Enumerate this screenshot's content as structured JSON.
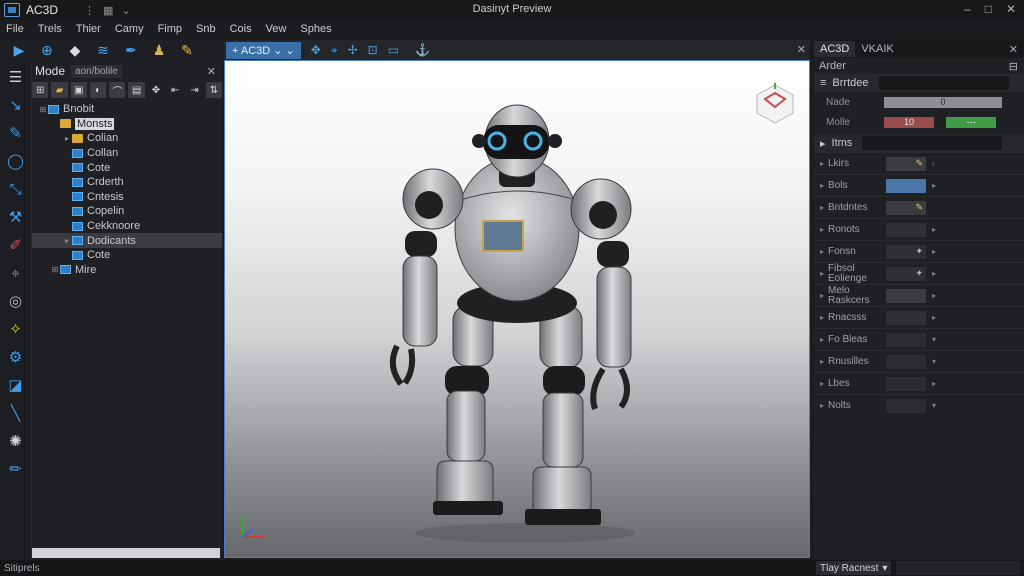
{
  "app": {
    "name": "AC3D",
    "window_title": "Dasinyt Preview"
  },
  "window_controls": [
    "–",
    "□",
    "✕"
  ],
  "menu": [
    "File",
    "Trels",
    "Thier",
    "Camy",
    "Fimp",
    "Snb",
    "Cois",
    "Vew",
    "Sphes"
  ],
  "toolbar": {
    "icons": [
      "play-icon",
      "zoom-icon",
      "cube-icon",
      "layers-icon",
      "pen-icon",
      "figure-icon",
      "brush-icon"
    ]
  },
  "left_tools": [
    "select-icon",
    "move-icon",
    "rotate-icon",
    "scale-icon",
    "wand-icon",
    "pencil-icon",
    "paint-icon",
    "lasso-icon",
    "sparkle-icon",
    "gear-icon",
    "slice-icon",
    "line-icon",
    "settings-icon",
    "brush-icon"
  ],
  "outliner": {
    "title": "Mode",
    "filter": "aon/bolile",
    "tree": [
      {
        "label": "Bnobit",
        "type": "mesh",
        "indent": 0,
        "expand": "⊞"
      },
      {
        "label": "Monsts",
        "type": "folder",
        "indent": 1,
        "expand": "",
        "hover": true
      },
      {
        "label": "Colian",
        "type": "folder",
        "indent": 2,
        "expand": "▸"
      },
      {
        "label": "Collan",
        "type": "mesh",
        "indent": 2,
        "expand": ""
      },
      {
        "label": "Cote",
        "type": "mesh",
        "indent": 2,
        "expand": ""
      },
      {
        "label": "Crderth",
        "type": "mesh",
        "indent": 2,
        "expand": ""
      },
      {
        "label": "Cntesis",
        "type": "mesh",
        "indent": 2,
        "expand": ""
      },
      {
        "label": "Copelin",
        "type": "mesh",
        "indent": 2,
        "expand": ""
      },
      {
        "label": "Cekknoore",
        "type": "mesh",
        "indent": 2,
        "expand": ""
      },
      {
        "label": "Dodicants",
        "type": "mesh",
        "indent": 2,
        "expand": "▸",
        "selected": true
      },
      {
        "label": "Cote",
        "type": "mesh",
        "indent": 2,
        "expand": ""
      },
      {
        "label": "Mire",
        "type": "mesh",
        "indent": 1,
        "expand": "⊞"
      }
    ]
  },
  "viewport": {
    "tab": "AC3D"
  },
  "right_panel": {
    "tabs": [
      "AC3D",
      "VKAIK"
    ],
    "subheader": "Arder",
    "section": "Brrtdee",
    "name_label": "Nade",
    "name_value": "0",
    "mode_label": "Molle",
    "mode_values": [
      "10",
      "---"
    ],
    "tree_header": "Itms",
    "params": [
      {
        "label": "Lkirs",
        "swatch": "grey",
        "mark": "✎",
        "chev": "‹"
      },
      {
        "label": "Bols",
        "swatch": "blue",
        "mark": "",
        "chev": "▸"
      },
      {
        "label": "Bntdntes",
        "swatch": "grey",
        "mark": "✎",
        "chev": ""
      },
      {
        "label": "Ronots",
        "swatch": "dark",
        "mark": "",
        "chev": "▸"
      },
      {
        "label": "Fonsn",
        "swatch": "dark",
        "mark": "✦",
        "chev": "▸"
      },
      {
        "label": "Fibsol Eolienge",
        "swatch": "dark",
        "mark": "✦",
        "chev": "▸"
      },
      {
        "label": "Melo Raskcers",
        "swatch": "grey",
        "mark": "",
        "chev": "▸"
      },
      {
        "label": "Rnacsss",
        "swatch": "dark",
        "mark": "",
        "chev": "▸"
      },
      {
        "label": "Fo Bleas",
        "swatch": "light",
        "mark": "",
        "chev": "▾"
      },
      {
        "label": "Rnusilles",
        "swatch": "light",
        "mark": "",
        "chev": "▾"
      },
      {
        "label": "Lbes",
        "swatch": "light",
        "mark": "",
        "chev": "▸"
      },
      {
        "label": "Nolts",
        "swatch": "light",
        "mark": "",
        "chev": "▾"
      }
    ]
  },
  "status": {
    "text": "Sitiprels",
    "dropdown": "Tlay Racnest"
  }
}
